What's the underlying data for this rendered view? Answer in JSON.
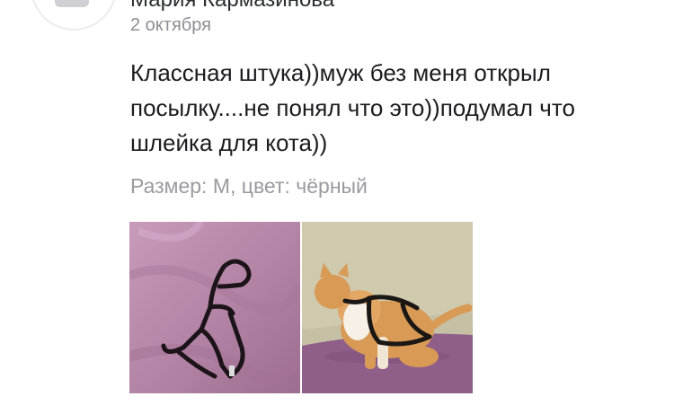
{
  "review": {
    "author": "Мария Кармазинова",
    "date": "2 октября",
    "text": "Классная штука))муж без меня открыл посылку....не понял что это))подумал что шлейка для кота))",
    "variant": "Размер: М, цвет: чёрный"
  },
  "photos": [
    {
      "name": "harness-on-blanket",
      "icon": "photo-harness"
    },
    {
      "name": "cat-in-harness",
      "icon": "photo-cat"
    }
  ],
  "colors": {
    "text": "#1c1c1e",
    "muted": "#9a9a9f",
    "blanket": "#b487a5",
    "cat": "#d89a55"
  }
}
